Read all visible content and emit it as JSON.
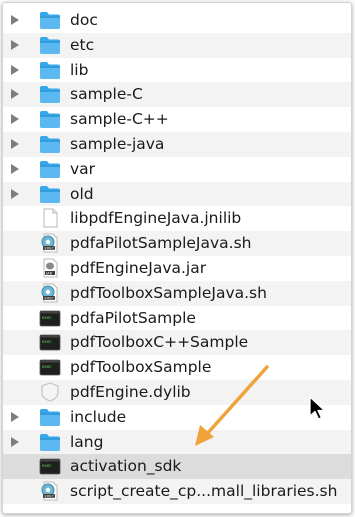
{
  "files": [
    {
      "name": "doc",
      "type": "folder"
    },
    {
      "name": "etc",
      "type": "folder"
    },
    {
      "name": "lib",
      "type": "folder"
    },
    {
      "name": "sample-C",
      "type": "folder"
    },
    {
      "name": "sample-C++",
      "type": "folder"
    },
    {
      "name": "sample-java",
      "type": "folder"
    },
    {
      "name": "var",
      "type": "folder"
    },
    {
      "name": "old",
      "type": "folder"
    },
    {
      "name": "libpdfEngineJava.jnilib",
      "type": "file-document"
    },
    {
      "name": "pdfaPilotSampleJava.sh",
      "type": "script"
    },
    {
      "name": "pdfEngineJava.jar",
      "type": "jar"
    },
    {
      "name": "pdfToolboxSampleJava.sh",
      "type": "script"
    },
    {
      "name": "pdfaPilotSample",
      "type": "executable"
    },
    {
      "name": "pdfToolboxC++Sample",
      "type": "executable"
    },
    {
      "name": "pdfToolboxSample",
      "type": "executable"
    },
    {
      "name": "pdfEngine.dylib",
      "type": "library"
    },
    {
      "name": "include",
      "type": "folder"
    },
    {
      "name": "lang",
      "type": "folder"
    },
    {
      "name": "activation_sdk",
      "type": "executable",
      "selected": true
    },
    {
      "name": "script_create_cp...mall_libraries.sh",
      "type": "script"
    }
  ],
  "colors": {
    "folder": "#37a7ea",
    "arrow": "#f0a33a",
    "selection": "#dcdcdc"
  }
}
